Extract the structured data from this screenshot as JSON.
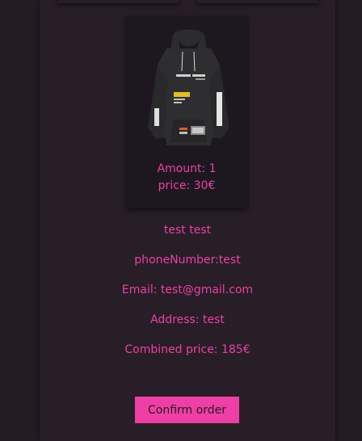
{
  "product": {
    "amount_text": "Amount: 1",
    "price_text": "price: 30€",
    "image_icon": "black-hoodie-image"
  },
  "customer": {
    "name": "test test",
    "phone": "phoneNumber:test",
    "email": "Email: test@gmail.com",
    "address": "Address: test"
  },
  "order": {
    "combined_price": "Combined price: 185€",
    "confirm_label": "Confirm order"
  },
  "colors": {
    "background": "#241c23",
    "panel": "#271e27",
    "accent": "#ef3fa6"
  }
}
